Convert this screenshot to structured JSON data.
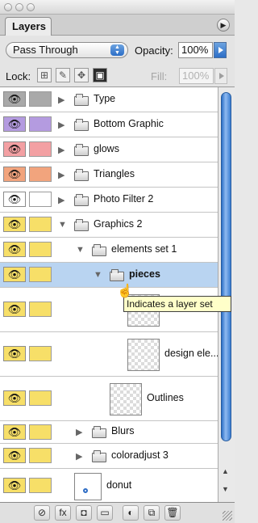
{
  "panel": {
    "tab_label": "Layers",
    "panel_menu_icon": "▶"
  },
  "controls": {
    "blend_mode": "Pass Through",
    "opacity_label": "Opacity:",
    "opacity_value": "100%",
    "lock_label": "Lock:",
    "fill_label": "Fill:",
    "fill_value": "100%"
  },
  "layers": [
    {
      "name": "Type",
      "kind": "set",
      "expanded": false,
      "indent": 0,
      "color": "#a9a9a9"
    },
    {
      "name": "Bottom Graphic",
      "kind": "set",
      "expanded": false,
      "indent": 0,
      "color": "#b49be0"
    },
    {
      "name": "glows",
      "kind": "set",
      "expanded": false,
      "indent": 0,
      "color": "#f3a0a3"
    },
    {
      "name": "Triangles",
      "kind": "set",
      "expanded": false,
      "indent": 0,
      "color": "#f2a47d"
    },
    {
      "name": "Photo Filter 2",
      "kind": "set",
      "expanded": false,
      "indent": 0,
      "color": "#ffffff"
    },
    {
      "name": "Graphics 2",
      "kind": "set",
      "expanded": true,
      "indent": 0,
      "color": "#f7df68"
    },
    {
      "name": "elements set 1",
      "kind": "set",
      "expanded": true,
      "indent": 1,
      "color": "#f7df68"
    },
    {
      "name": "pieces",
      "kind": "set",
      "expanded": true,
      "indent": 2,
      "color": "#f7df68",
      "selected": true
    },
    {
      "name": "",
      "kind": "layer",
      "indent": 3,
      "color": "#f7df68"
    },
    {
      "name": "design ele...",
      "kind": "layer",
      "indent": 3,
      "color": "#f7df68"
    },
    {
      "name": "Outlines",
      "kind": "layer",
      "indent": 2,
      "color": "#f7df68"
    },
    {
      "name": "Blurs",
      "kind": "set",
      "expanded": false,
      "indent": 1,
      "color": "#f7df68"
    },
    {
      "name": "coloradjust 3",
      "kind": "set",
      "expanded": false,
      "indent": 1,
      "color": "#f7df68"
    },
    {
      "name": "donut",
      "kind": "layer",
      "indent": 0,
      "color": "#f7df68"
    }
  ],
  "tooltip": "Indicates a layer set",
  "toolbar": {
    "icons": [
      "link-layers-icon",
      "layer-style-icon",
      "layer-mask-icon",
      "new-set-icon",
      "adjustment-layer-icon",
      "new-layer-icon",
      "trash-icon"
    ],
    "glyphs": [
      "⊘",
      "fx",
      "◘",
      "▭",
      "◐",
      "⧉",
      "🗑"
    ]
  }
}
